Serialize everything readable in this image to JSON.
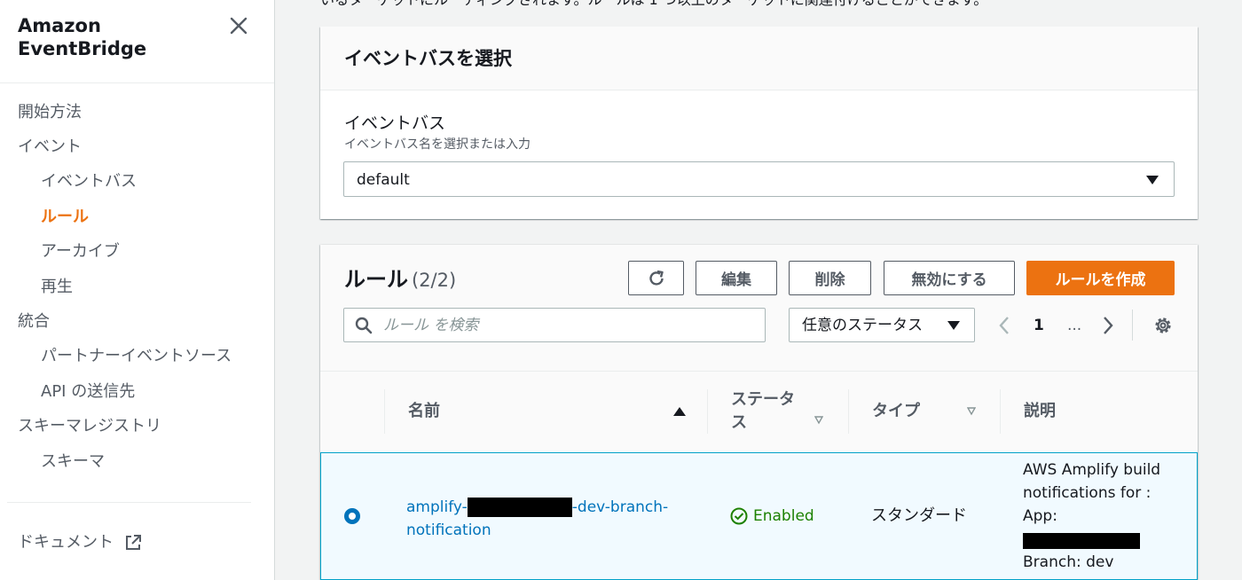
{
  "sidebar": {
    "title": "Amazon EventBridge",
    "items": [
      {
        "label": "開始方法"
      },
      {
        "label": "イベント"
      },
      {
        "label": "イベントバス"
      },
      {
        "label": "ルール"
      },
      {
        "label": "アーカイブ"
      },
      {
        "label": "再生"
      },
      {
        "label": "統合"
      },
      {
        "label": "パートナーイベントソース"
      },
      {
        "label": "API の送信先"
      },
      {
        "label": "スキーマレジストリ"
      },
      {
        "label": "スキーマ"
      }
    ],
    "docs_label": "ドキュメント",
    "active_color": "#ec7211"
  },
  "intro_text": "いるターゲットにルーティングされます。ルールは 1 つ以上のターゲットに関連付けることができます。",
  "event_bus_panel": {
    "title": "イベントバスを選択",
    "field_label": "イベントバス",
    "field_description": "イベントバス名を選択または入力",
    "selected_value": "default"
  },
  "rules_panel": {
    "title": "ルール",
    "count": "(2/2)",
    "buttons": {
      "edit": "編集",
      "delete": "削除",
      "disable": "無効にする",
      "create": "ルールを作成"
    },
    "search_placeholder": "ルール を検索",
    "status_filter": "任意のステータス",
    "pagination": {
      "current_page": "1",
      "ellipsis": "..."
    },
    "columns": {
      "name": "名前",
      "status": "ステータス",
      "type": "タイプ",
      "description": "説明"
    },
    "rows": [
      {
        "name_prefix": "amplify-",
        "name_suffix": "-dev-branch-notification",
        "status": "Enabled",
        "type": "スタンダード",
        "desc_line1": "AWS Amplify build notifications for :",
        "desc_line2": "App:",
        "desc_line4": "Branch: dev"
      }
    ]
  },
  "colors": {
    "primary_button": "#ec7211",
    "link": "#0073bb",
    "status_enabled": "#1d8102",
    "selected_row_bg": "#f1faff",
    "selected_row_border": "#00a1c9"
  }
}
